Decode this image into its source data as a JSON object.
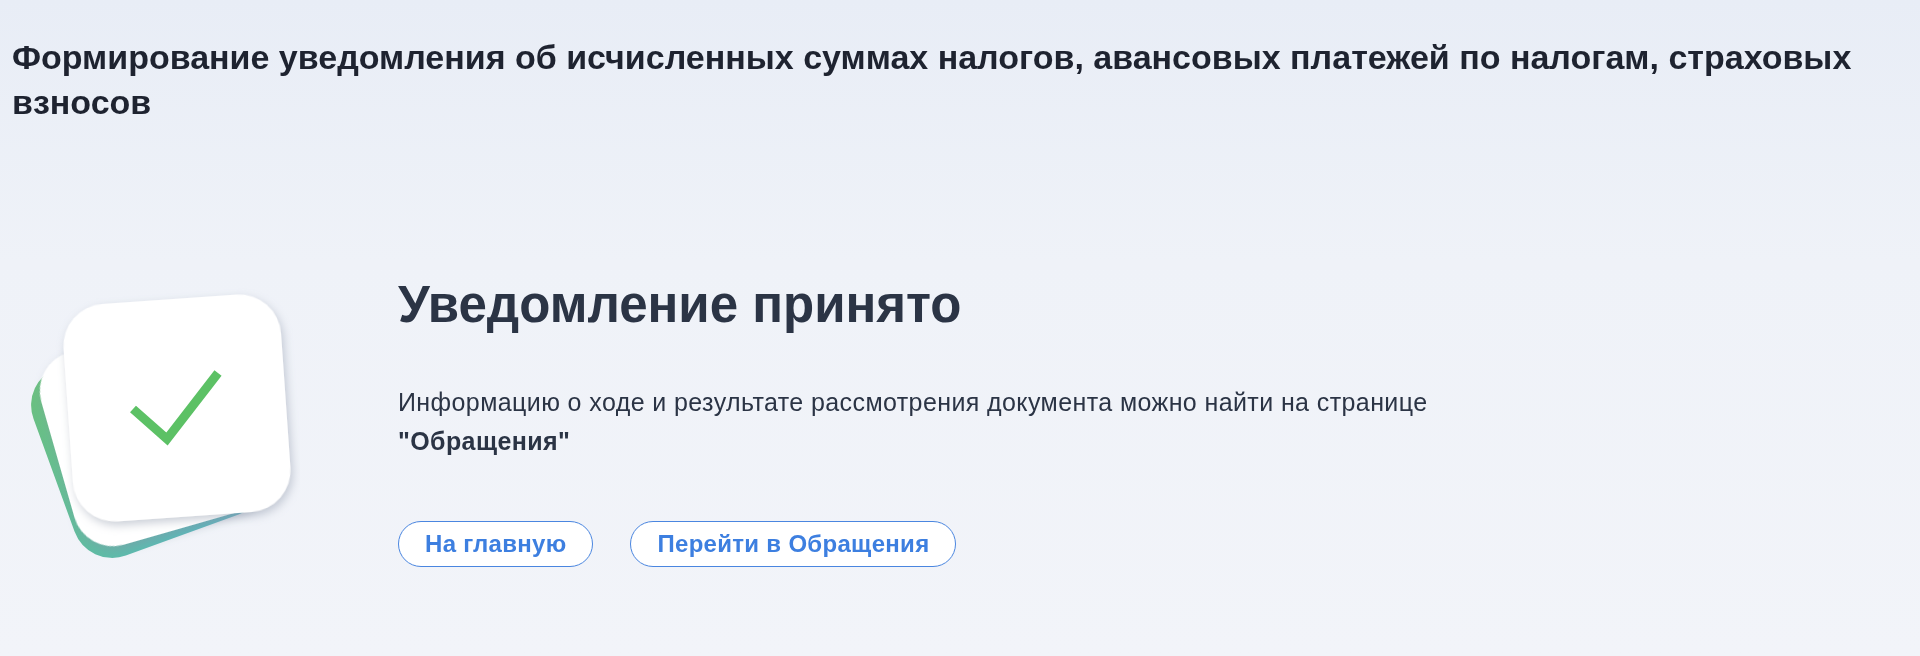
{
  "header": {
    "title": "Формирование уведомления об исчисленных суммах налогов, авансовых платежей по налогам, страховых взносов"
  },
  "result": {
    "heading": "Уведомление принято",
    "message": "Информацию о ходе и результате рассмотрения документа можно найти на странице **\"Обращения\"**",
    "buttons": [
      {
        "label": "На главную"
      },
      {
        "label": "Перейти в Обращения"
      }
    ]
  }
}
